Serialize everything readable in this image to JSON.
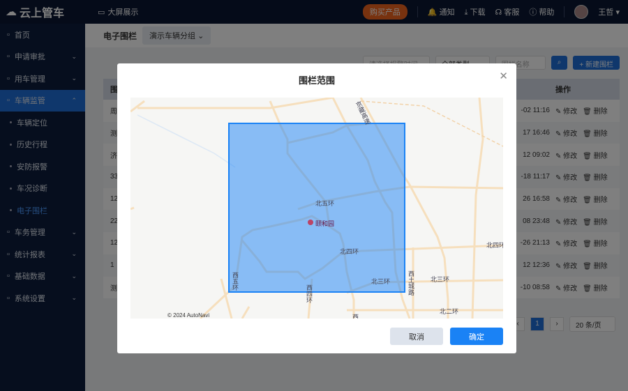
{
  "header": {
    "logo": "云上管车",
    "screen": "大屏展示",
    "buy": "购买产品",
    "notice": "通知",
    "download": "下载",
    "service": "客服",
    "help": "帮助",
    "user": "王哲"
  },
  "sidebar": {
    "items": [
      {
        "label": "首页",
        "icon": "home-icon"
      },
      {
        "label": "申请审批",
        "icon": "stamp-icon",
        "chev": "⌄"
      },
      {
        "label": "用车管理",
        "icon": "car-icon",
        "chev": "⌄"
      },
      {
        "label": "车辆监管",
        "icon": "monitor-icon",
        "chev": "⌃",
        "active": true
      },
      {
        "label": "车辆定位",
        "sub": true
      },
      {
        "label": "历史行程",
        "sub": true
      },
      {
        "label": "安防报警",
        "sub": true
      },
      {
        "label": "车况诊断",
        "sub": true
      },
      {
        "label": "电子围栏",
        "sub": true,
        "current": true
      },
      {
        "label": "车务管理",
        "icon": "task-icon",
        "chev": "⌄"
      },
      {
        "label": "统计报表",
        "icon": "report-icon",
        "chev": "⌄"
      },
      {
        "label": "基础数据",
        "icon": "data-icon",
        "chev": "⌄"
      },
      {
        "label": "系统设置",
        "icon": "settings-icon",
        "chev": "⌄"
      }
    ]
  },
  "main": {
    "title": "电子围栏",
    "group": "演示车辆分组",
    "date_placeholder": "请选择报警时间",
    "type": "全部类型",
    "name_placeholder": "围栏名称",
    "new": "+ 新建围栏",
    "col_first": "围",
    "col_action": "操作",
    "rows": [
      [
        "周",
        "-02 11:16"
      ],
      [
        "测",
        "17 16:46"
      ],
      [
        "济",
        "12 09:02"
      ],
      [
        "33",
        "-18 11:17"
      ],
      [
        "12",
        "26 16:58"
      ],
      [
        "22",
        "08 23:48"
      ],
      [
        "12",
        "-26 21:13"
      ],
      [
        "1",
        "12 12:36"
      ],
      [
        "测",
        "-10 08:58"
      ]
    ],
    "edit": "修改",
    "delete": "删除",
    "page": "1",
    "page_size": "20 条/页"
  },
  "modal": {
    "title": "围栏范围",
    "cancel": "取消",
    "ok": "确定",
    "map": {
      "copyright": "© 2024 AutoNavi",
      "poi": "颐和园",
      "labels": [
        "北五环",
        "北四环",
        "西五环",
        "西四环",
        "北三环",
        "西土城路",
        "北三环",
        "北四环",
        "北二环",
        "西",
        "京藏高速"
      ]
    },
    "fence_color": "#1a82f5"
  }
}
